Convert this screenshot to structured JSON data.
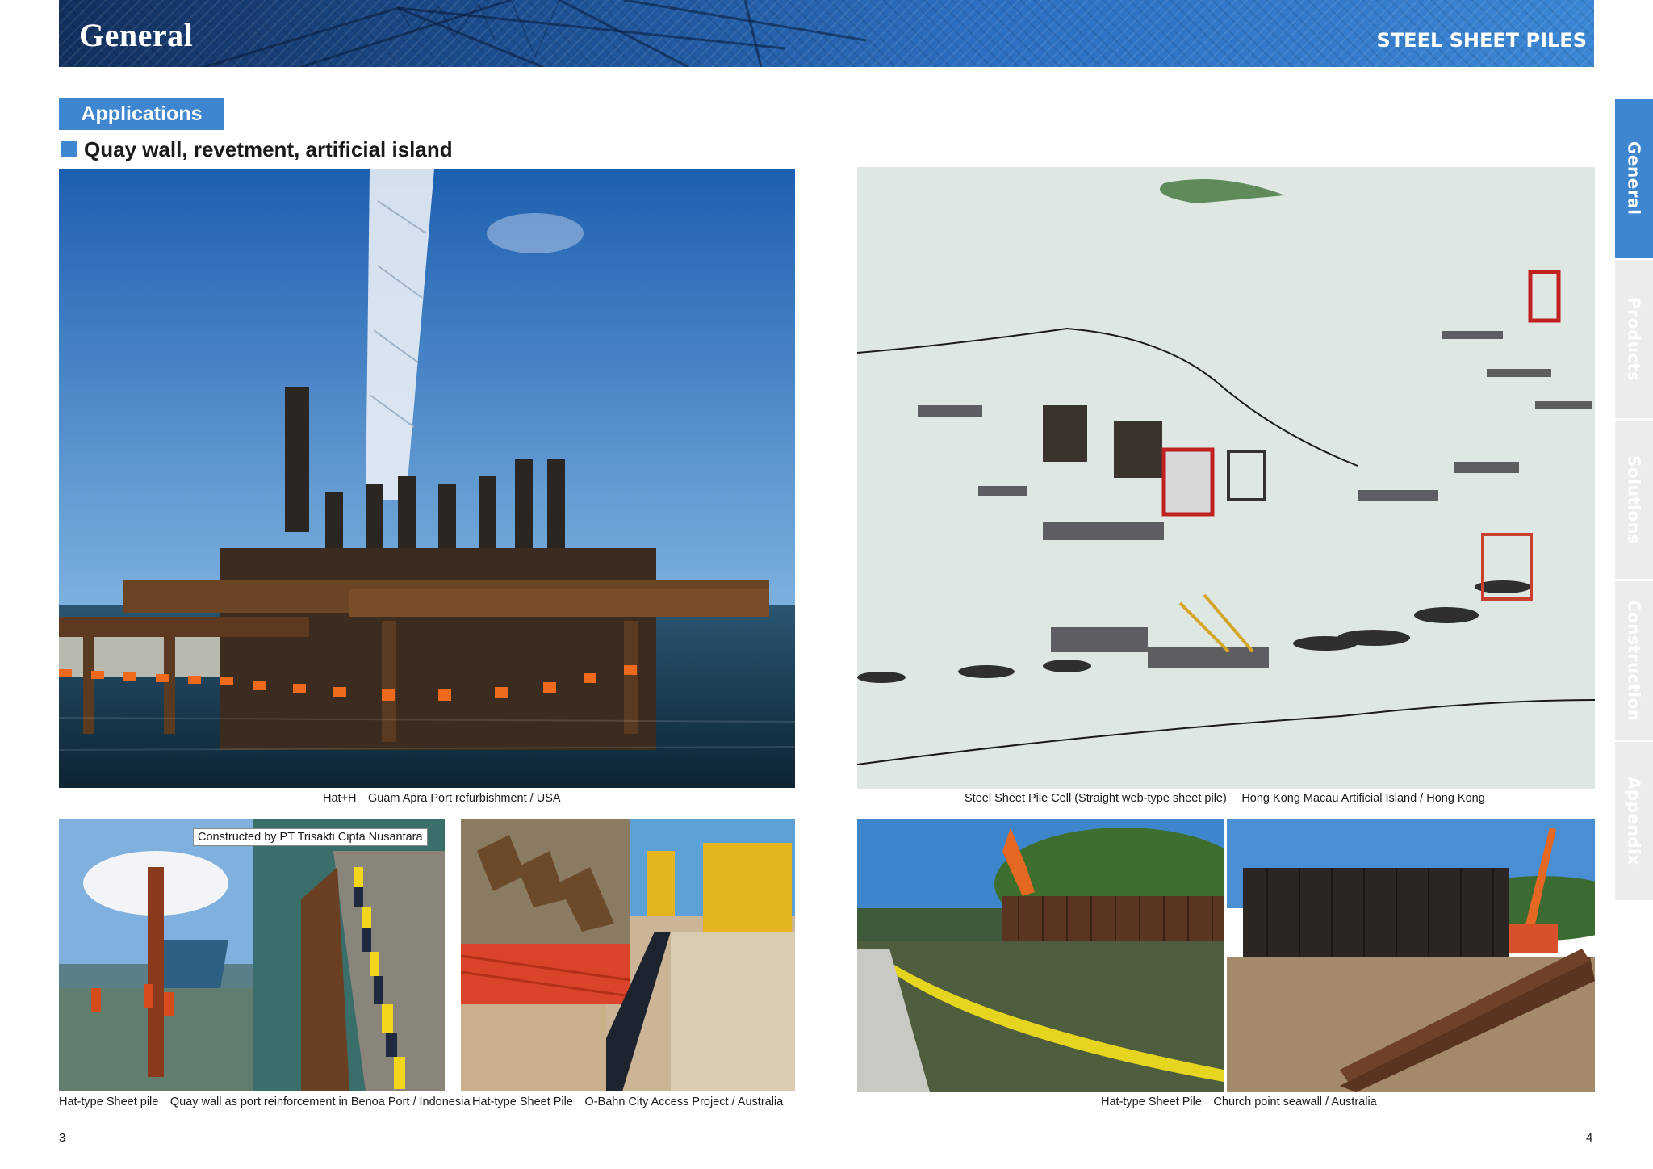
{
  "header": {
    "title": "General",
    "right_title": "STEEL SHEET PILES"
  },
  "section": {
    "label": "Applications",
    "subheading": "Quay wall, revetment, artificial island"
  },
  "captions": {
    "guam": "Hat+H Guam Apra Port refurbishment / USA",
    "hongkong": "Steel Sheet Pile Cell (Straight web-type sheet pile)  Hong Kong Macau Artificial Island / Hong Kong",
    "benoa": "Hat-type Sheet pile Quay wall as port reinforcement in Benoa Port / Indonesia",
    "obahn": "Hat-type Sheet Pile O-Bahn City Access Project / Australia",
    "church": "Hat-type Sheet Pile Church point seawall / Australia"
  },
  "photo_note": "Constructed by PT Trisakti Cipta Nusantara",
  "page_numbers": {
    "left": "3",
    "right": "4"
  },
  "side_tabs": [
    {
      "label": "General",
      "active": true
    },
    {
      "label": "Products",
      "active": false
    },
    {
      "label": "Solutions",
      "active": false
    },
    {
      "label": "Construction",
      "active": false
    },
    {
      "label": "Appendix",
      "active": false
    }
  ],
  "colors": {
    "accent": "#3f86d0",
    "header_dark": "#12305e",
    "tab_inactive": "#ececec"
  }
}
